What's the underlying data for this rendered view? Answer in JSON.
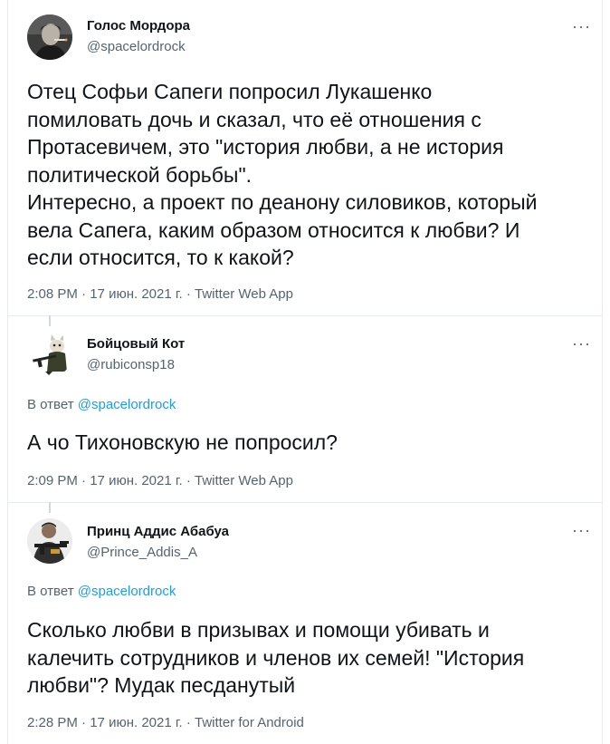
{
  "tweets": [
    {
      "author_name": "Голос Мордора",
      "author_handle": "@spacelordrock",
      "more_label": "···",
      "reply_to_label": "",
      "reply_to_handle": "",
      "text": "Отец Софьи Сапеги попросил Лукашенко\nпомиловать дочь и сказал, что её отношения с\nПротасевичем, это \"история любви, а не история\nполитической борьбы\".\nИнтересно, а проект по деанону силовиков, который\nвела Сапега, каким образом относится к любви? И\nесли относится, то к какой?",
      "time": "2:08 PM",
      "date": "17 июн. 2021 г.",
      "client": "Twitter Web App",
      "avatar_icon": "man-smoking-avatar"
    },
    {
      "author_name": "Бойцовый Кот",
      "author_handle": "@rubiconsp18",
      "more_label": "···",
      "reply_to_label": "В ответ",
      "reply_to_handle": "@spacelordrock",
      "text": "А чо Тихоновскую не попросил?",
      "time": "2:09 PM",
      "date": "17 июн. 2021 г.",
      "client": "Twitter Web App",
      "avatar_icon": "armed-cat-avatar"
    },
    {
      "author_name": "Принц Аддис Абабуа",
      "author_handle": "@Prince_Addis_A",
      "more_label": "···",
      "reply_to_label": "В ответ",
      "reply_to_handle": "@spacelordrock",
      "text": "Сколько любви в призывах и помощи убивать и\nкалечить сотрудников и членов их семей! \"История\nлюбви\"? Мудак песданутый",
      "time": "2:28 PM",
      "date": "17 июн. 2021 г.",
      "client": "Twitter for Android",
      "avatar_icon": "armed-figure-avatar"
    }
  ],
  "separator": "·",
  "colors": {
    "text": "#0f1419",
    "secondary": "#536471",
    "link": "#1d9bf0",
    "border": "#e6ecf0"
  }
}
